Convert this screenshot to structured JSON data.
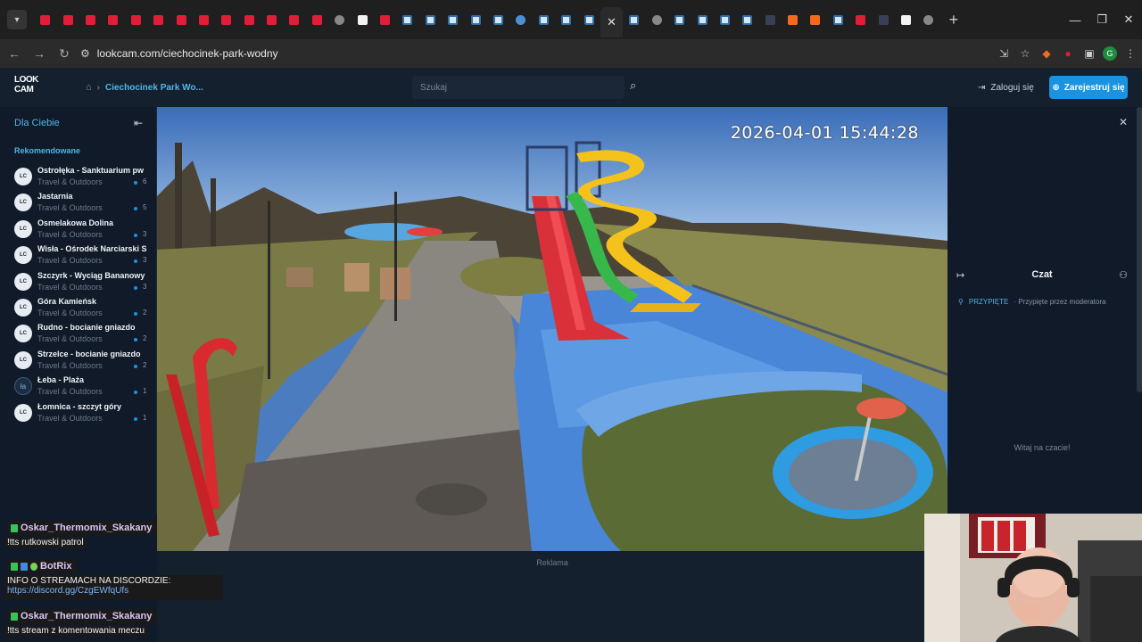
{
  "browser": {
    "url": "lookcam.com/ciechocinek-park-wodny",
    "tab_icons": [
      "red",
      "red",
      "red",
      "red",
      "red",
      "red",
      "red",
      "red",
      "red",
      "red",
      "red",
      "red",
      "red",
      "gray",
      "white",
      "red",
      "lc",
      "lc",
      "lc",
      "lc",
      "lc",
      "globe",
      "lc",
      "lc",
      "lc",
      "active",
      "lc",
      "gray",
      "lc",
      "lc",
      "lc",
      "lc",
      "dark",
      "orange",
      "orange",
      "lc",
      "red",
      "dark",
      "white",
      "gray"
    ],
    "active_tab_close": "✕",
    "new_tab": "+",
    "profile_initial": "G"
  },
  "site": {
    "logo_line1": "LOOK",
    "logo_line2": "CAM",
    "breadcrumb_current": "Ciechocinek Park Wo...",
    "search_placeholder": "Szukaj",
    "login_label": "Zaloguj się",
    "register_label": "Zarejestruj się"
  },
  "sidebar": {
    "title": "Dla Ciebie",
    "section": "Rekomendowane",
    "items": [
      {
        "name": "Ostrołęka - Sanktuarium pw",
        "category": "Travel & Outdoors",
        "viewers": "6",
        "avatar": "LC"
      },
      {
        "name": "Jastarnia",
        "category": "Travel & Outdoors",
        "viewers": "5",
        "avatar": "LC"
      },
      {
        "name": "Osmelakowa Dolina",
        "category": "Travel & Outdoors",
        "viewers": "3",
        "avatar": "LC"
      },
      {
        "name": "Wisła - Ośrodek Narciarski S",
        "category": "Travel & Outdoors",
        "viewers": "3",
        "avatar": "LC"
      },
      {
        "name": "Szczyrk - Wyciąg Bananowy",
        "category": "Travel & Outdoors",
        "viewers": "3",
        "avatar": "LC"
      },
      {
        "name": "Góra Kamieńsk",
        "category": "Travel & Outdoors",
        "viewers": "2",
        "avatar": "LC"
      },
      {
        "name": "Rudno - bocianie gniazdo",
        "category": "Travel & Outdoors",
        "viewers": "2",
        "avatar": "LC"
      },
      {
        "name": "Strzelce - bocianie gniazdo",
        "category": "Travel & Outdoors",
        "viewers": "2",
        "avatar": "LC"
      },
      {
        "name": "Łeba - Plaża",
        "category": "Travel & Outdoors",
        "viewers": "1",
        "avatar": "ła"
      },
      {
        "name": "Łomnica - szczyt góry",
        "category": "Travel & Outdoors",
        "viewers": "1",
        "avatar": "LC"
      }
    ]
  },
  "video": {
    "timestamp": "2026-04-01 15:44:28"
  },
  "ad_label": "Reklama",
  "chat": {
    "title": "Czat",
    "pinned_label": "PRZYPIĘTE",
    "pinned_desc": "· Przypięte przez moderatora",
    "welcome": "Witaj na czacie!"
  },
  "stream_chat": [
    {
      "user": "Oskar_Thermomix_Skakany",
      "text": "!tts rutkowski patrol",
      "link": ""
    },
    {
      "user": "BotRix",
      "text": "INFO O STREAMACH NA DISCORDZIE:",
      "link": "https://discord.gg/CzgEWfqUfs"
    },
    {
      "user": "Oskar_Thermomix_Skakany",
      "text": "!tts stream z komentowania meczu",
      "link": ""
    }
  ],
  "colors": {
    "accent": "#1a93e0",
    "link": "#4fb6e8",
    "page_bg": "#0f1a2a"
  }
}
